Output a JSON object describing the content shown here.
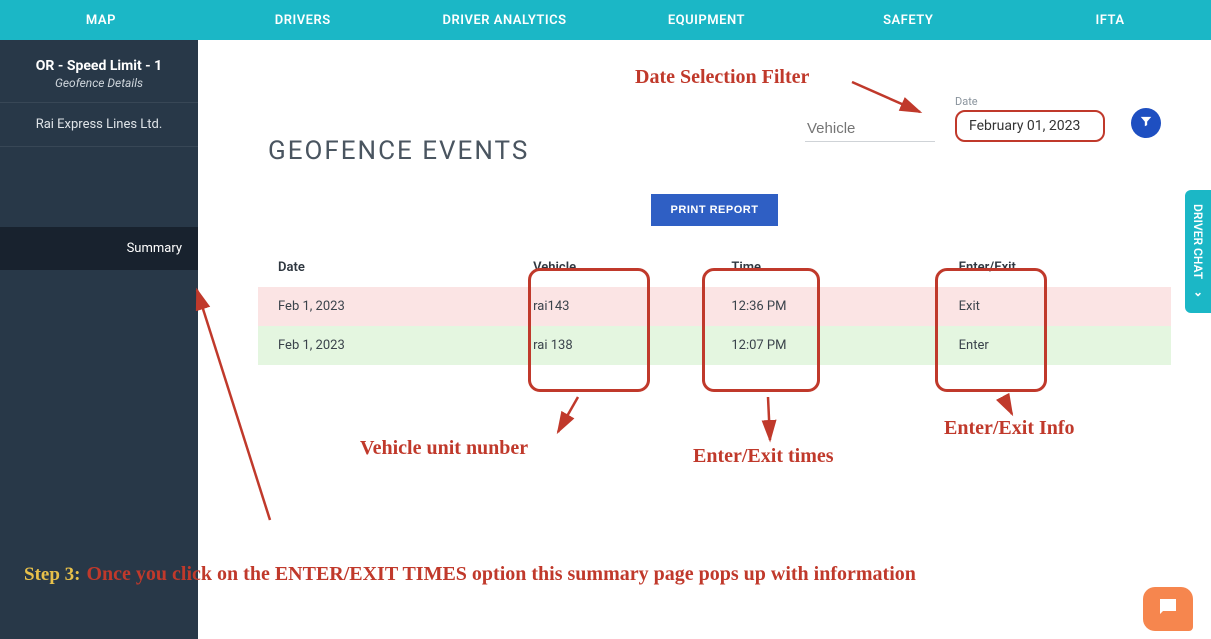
{
  "topnav": [
    "MAP",
    "DRIVERS",
    "DRIVER ANALYTICS",
    "EQUIPMENT",
    "SAFETY",
    "IFTA"
  ],
  "sidebar": {
    "title": "OR - Speed Limit - 1",
    "subtitle": "Geofence Details",
    "company": "Rai Express Lines Ltd.",
    "summary": "Summary"
  },
  "filters": {
    "vehicle_placeholder": "Vehicle",
    "date_label": "Date",
    "date_value": "February 01, 2023"
  },
  "page_title": "GEOFENCE EVENTS",
  "print_label": "PRINT REPORT",
  "table": {
    "headers": [
      "Date",
      "Vehicle",
      "Time",
      "Enter/Exit"
    ],
    "rows": [
      {
        "date": "Feb 1, 2023",
        "vehicle": "rai143",
        "time": "12:36 PM",
        "action": "Exit",
        "type": "exit"
      },
      {
        "date": "Feb 1, 2023",
        "vehicle": "rai 138",
        "time": "12:07 PM",
        "action": "Enter",
        "type": "enter"
      }
    ]
  },
  "driver_chat": "DRIVER CHAT",
  "annotations": {
    "date_filter": "Date Selection Filter",
    "vehicle_unit": "Vehicle unit nunber",
    "times": "Enter/Exit times",
    "info": "Enter/Exit Info",
    "step_label": "Step 3:",
    "step_text": "Once you click on the ENTER/EXIT TIMES option this summary page pops up with information"
  }
}
